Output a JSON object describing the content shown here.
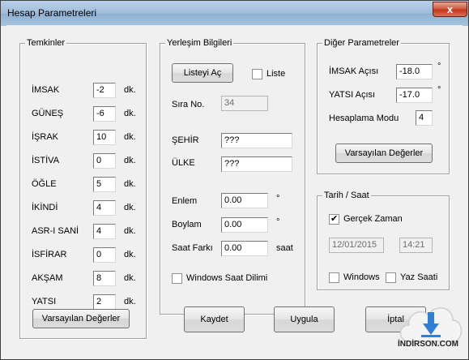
{
  "window": {
    "title": "Hesap Parametreleri",
    "close": "x"
  },
  "temkinler": {
    "legend": "Temkinler",
    "unit": "dk.",
    "rows": [
      {
        "label": "İMSAK",
        "value": "-2"
      },
      {
        "label": "GÜNEŞ",
        "value": "-6"
      },
      {
        "label": "İŞRAK",
        "value": "10"
      },
      {
        "label": "İSTİVA",
        "value": "0"
      },
      {
        "label": "ÖĞLE",
        "value": "5"
      },
      {
        "label": "İKİNDİ",
        "value": "4"
      },
      {
        "label": "ASR-I SANİ",
        "value": "4"
      },
      {
        "label": "İSFİRAR",
        "value": "0"
      },
      {
        "label": "AKŞAM",
        "value": "8"
      },
      {
        "label": "YATSI",
        "value": "2"
      }
    ],
    "defaults_button": "Varsayılan Değerler"
  },
  "yerlesim": {
    "legend": "Yerleşim Bilgileri",
    "list_button": "Listeyi Aç",
    "list_checkbox": "Liste",
    "sira_label": "Sıra No.",
    "sira_value": "34",
    "sehir_label": "ŞEHİR",
    "sehir_value": "???",
    "ulke_label": "ÜLKE",
    "ulke_value": "???",
    "enlem_label": "Enlem",
    "enlem_value": "0.00",
    "enlem_unit": "°",
    "boylam_label": "Boylam",
    "boylam_value": "0.00",
    "boylam_unit": "°",
    "saat_label": "Saat Farkı",
    "saat_value": "0.00",
    "saat_unit": "saat",
    "windows_tz": "Windows Saat Dilimi"
  },
  "diger": {
    "legend": "Diğer Parametreler",
    "imsak_label": "İMSAK Açısı",
    "imsak_value": "-18.0",
    "imsak_unit": "°",
    "yatsi_label": "YATSI Açısı",
    "yatsi_value": "-17.0",
    "yatsi_unit": "°",
    "mod_label": "Hesaplama Modu",
    "mod_value": "4",
    "defaults_button": "Varsayılan Değerler"
  },
  "tarih": {
    "legend": "Tarih / Saat",
    "real_time": "Gerçek Zaman",
    "real_time_checked": true,
    "date_value": "12/01/2015",
    "time_value": "14:21",
    "windows": "Windows",
    "dst": "Yaz Saati"
  },
  "footer": {
    "save": "Kaydet",
    "apply": "Uygula",
    "cancel": "İptal"
  },
  "watermark": {
    "text": "İNDİRSON.COM"
  }
}
